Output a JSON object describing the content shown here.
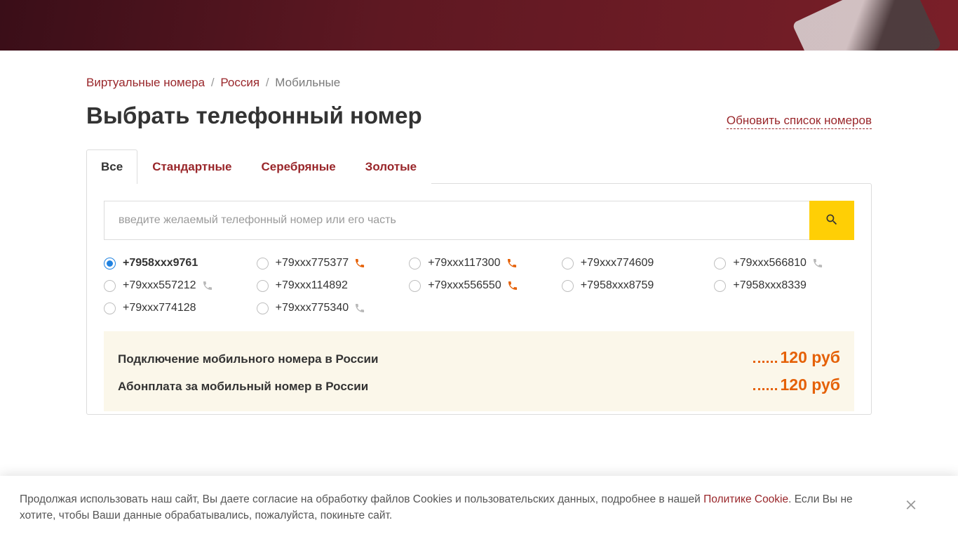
{
  "breadcrumb": {
    "link1": "Виртуальные номера",
    "link2": "Россия",
    "current": "Мобильные"
  },
  "title": "Выбрать телефонный номер",
  "refresh": "Обновить список номеров",
  "tabs": {
    "all": "Все",
    "standard": "Стандартные",
    "silver": "Серебряные",
    "gold": "Золотые"
  },
  "search": {
    "placeholder": "введите желаемый телефонный номер или его часть"
  },
  "numbers": [
    {
      "display": "+7958xxx9761",
      "selected": true,
      "phone": null
    },
    {
      "display": "+79xxx775377",
      "selected": false,
      "phone": "orange"
    },
    {
      "display": "+79xxx117300",
      "selected": false,
      "phone": "orange"
    },
    {
      "display": "+79xxx774609",
      "selected": false,
      "phone": null
    },
    {
      "display": "+79xxx566810",
      "selected": false,
      "phone": "gray"
    },
    {
      "display": "+79xxx557212",
      "selected": false,
      "phone": "gray"
    },
    {
      "display": "+79xxx114892",
      "selected": false,
      "phone": null
    },
    {
      "display": "+79xxx556550",
      "selected": false,
      "phone": "orange"
    },
    {
      "display": "+7958xxx8759",
      "selected": false,
      "phone": null
    },
    {
      "display": "+7958xxx8339",
      "selected": false,
      "phone": null
    },
    {
      "display": "+79xxx774128",
      "selected": false,
      "phone": null
    },
    {
      "display": "+79xxx775340",
      "selected": false,
      "phone": "gray"
    }
  ],
  "pricing": {
    "setup_lbl": "Подключение мобильного номера в России",
    "setup_val": "120 руб",
    "monthly_lbl": "Абонплата за мобильный номер в России",
    "monthly_val": "120 руб"
  },
  "cookie": {
    "text1": "Продолжая использовать наш сайт, Вы даете согласие на обработку файлов Cookies и пользовательских данных, подробнее в нашей ",
    "link": "Политике Cookie",
    "text2": ". Если Вы не хотите, чтобы Ваши данные обрабатывались, пожалуйста, покиньте сайт."
  }
}
